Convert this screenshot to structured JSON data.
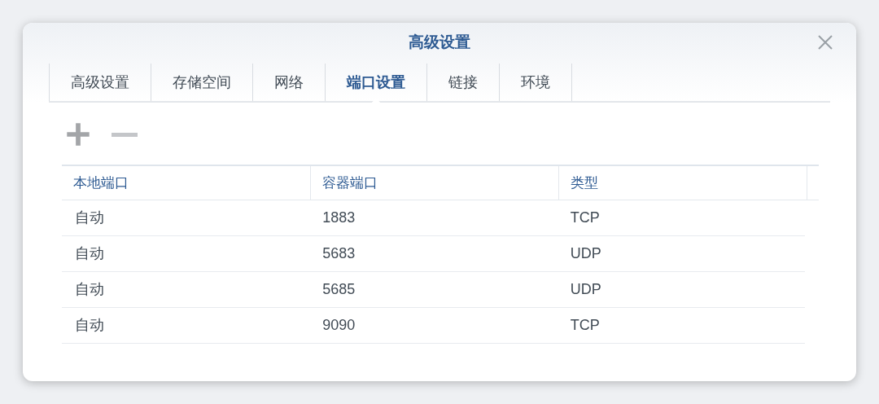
{
  "window": {
    "title": "高级设置"
  },
  "tabs": [
    {
      "label": "高级设置",
      "selected": false
    },
    {
      "label": "存储空间",
      "selected": false
    },
    {
      "label": "网络",
      "selected": false
    },
    {
      "label": "端口设置",
      "selected": true
    },
    {
      "label": "链接",
      "selected": false
    },
    {
      "label": "环境",
      "selected": false
    }
  ],
  "toolbar": [
    {
      "kind": "add",
      "disabled": false
    },
    {
      "kind": "remove",
      "disabled": true
    }
  ],
  "table": {
    "columns": [
      "本地端口",
      "容器端口",
      "类型"
    ],
    "rows": [
      [
        "自动",
        "1883",
        "TCP"
      ],
      [
        "自动",
        "5683",
        "UDP"
      ],
      [
        "自动",
        "5685",
        "UDP"
      ],
      [
        "自动",
        "9090",
        "TCP"
      ]
    ]
  }
}
